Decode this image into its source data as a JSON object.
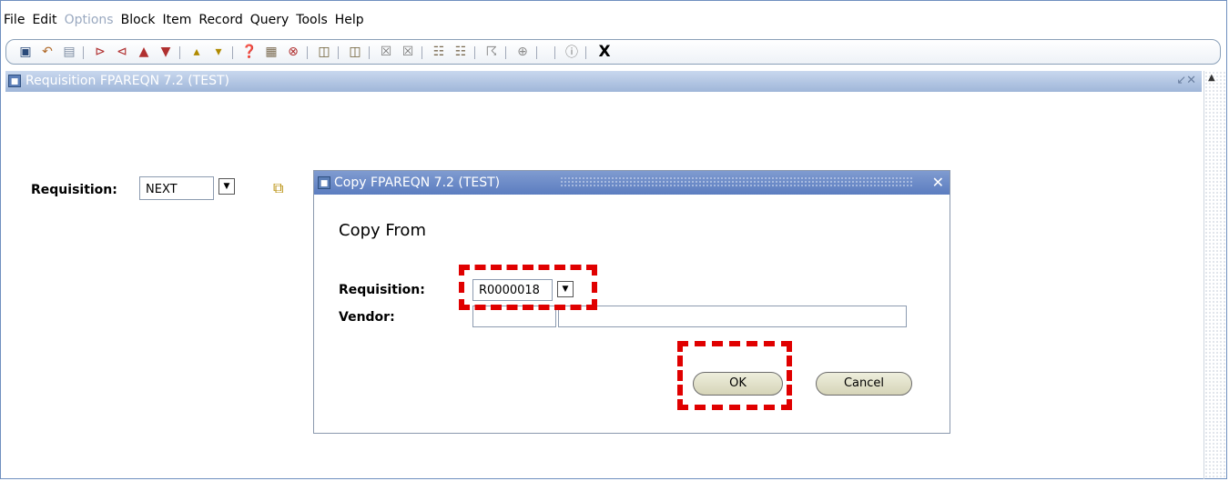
{
  "menu": [
    {
      "label": "File",
      "enabled": true
    },
    {
      "label": "Edit",
      "enabled": true
    },
    {
      "label": "Options",
      "enabled": false
    },
    {
      "label": "Block",
      "enabled": true
    },
    {
      "label": "Item",
      "enabled": true
    },
    {
      "label": "Record",
      "enabled": true
    },
    {
      "label": "Query",
      "enabled": true
    },
    {
      "label": "Tools",
      "enabled": true
    },
    {
      "label": "Help",
      "enabled": true
    }
  ],
  "toolbar": {
    "icons": [
      "save-icon",
      "rollback-icon",
      "print-icon",
      "insert-record-icon",
      "remove-record-icon",
      "previous-record-icon",
      "next-record-icon",
      "previous-block-icon",
      "next-block-icon",
      "enter-query-icon",
      "execute-query-icon",
      "cancel-query-icon",
      "export-icon",
      "print-all-icon",
      "clear-record-icon",
      "clear-form-icon",
      "options-icon",
      "related-icon",
      "audit-icon",
      "navigate-icon",
      "help-icon"
    ],
    "exit_label": "X"
  },
  "window": {
    "title": "Requisition  FPAREQN  7.2  (TEST)",
    "controls": "↙✕"
  },
  "main_form": {
    "requisition_label": "Requisition:",
    "requisition_value": "NEXT"
  },
  "dialog": {
    "title": "Copy   FPAREQN  7.2  (TEST)",
    "heading": "Copy From",
    "requisition_label": "Requisition:",
    "requisition_value": "R0000018",
    "vendor_label": "Vendor:",
    "vendor_id": "",
    "vendor_name": "",
    "ok_label": "OK",
    "cancel_label": "Cancel",
    "close_glyph": "✕"
  },
  "colors": {
    "highlight": "#e00000",
    "titlebar": "#5c7dc0",
    "button": "#d6d4b8"
  }
}
